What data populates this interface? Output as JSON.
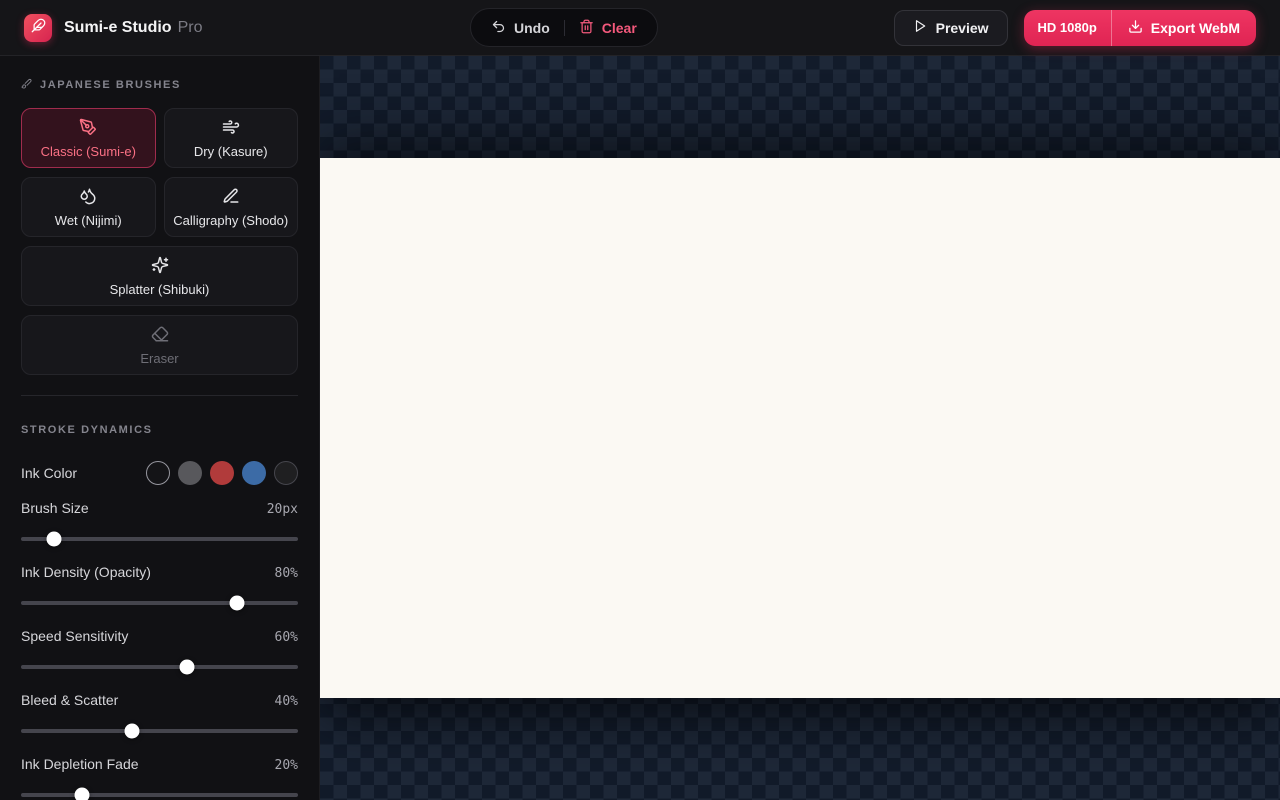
{
  "header": {
    "app_title": "Sumi-e Studio",
    "app_badge": "Pro",
    "undo_label": "Undo",
    "clear_label": "Clear",
    "preview_label": "Preview",
    "quality_label": "HD 1080p",
    "export_label": "Export WebM"
  },
  "sidebar": {
    "brushes": {
      "title": "JAPANESE BRUSHES",
      "items": [
        {
          "label": "Classic (Sumi-e)",
          "icon": "pen-nib-icon",
          "selected": true,
          "disabled": false,
          "wide": false
        },
        {
          "label": "Dry (Kasure)",
          "icon": "wind-icon",
          "selected": false,
          "disabled": false,
          "wide": false
        },
        {
          "label": "Wet (Nijimi)",
          "icon": "droplets-icon",
          "selected": false,
          "disabled": false,
          "wide": false
        },
        {
          "label": "Calligraphy (Shodo)",
          "icon": "pen-line-icon",
          "selected": false,
          "disabled": false,
          "wide": false
        },
        {
          "label": "Splatter (Shibuki)",
          "icon": "sparkles-icon",
          "selected": false,
          "disabled": false,
          "wide": true
        },
        {
          "label": "Eraser",
          "icon": "eraser-icon",
          "selected": false,
          "disabled": true,
          "wide": true
        }
      ]
    },
    "dynamics": {
      "title": "STROKE DYNAMICS",
      "ink_color_label": "Ink Color",
      "swatches": [
        {
          "name": "black",
          "color": "#141417",
          "selected": true,
          "outlined": false
        },
        {
          "name": "gray",
          "color": "#58585c",
          "selected": false,
          "outlined": false
        },
        {
          "name": "red",
          "color": "#b13b3b",
          "selected": false,
          "outlined": false
        },
        {
          "name": "blue",
          "color": "#3c6ba6",
          "selected": false,
          "outlined": false
        },
        {
          "name": "white",
          "color": "rgba(255,255,255,0.06)",
          "selected": false,
          "outlined": true
        }
      ],
      "sliders": [
        {
          "label": "Brush Size",
          "value": "20px",
          "percent": 12
        },
        {
          "label": "Ink Density (Opacity)",
          "value": "80%",
          "percent": 78
        },
        {
          "label": "Speed Sensitivity",
          "value": "60%",
          "percent": 60
        },
        {
          "label": "Bleed & Scatter",
          "value": "40%",
          "percent": 40
        },
        {
          "label": "Ink Depletion Fade",
          "value": "20%",
          "percent": 22
        }
      ]
    }
  },
  "colors": {
    "accent": "#e72e5b",
    "selected_brush_text": "#fb7185",
    "paper": "#fbf9f3",
    "checker_light": "#1e2838",
    "checker_dark": "#121b2a"
  }
}
